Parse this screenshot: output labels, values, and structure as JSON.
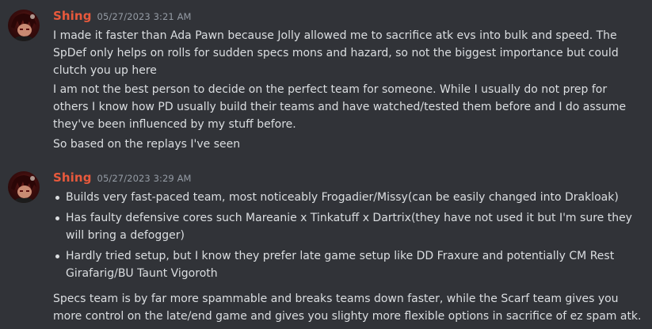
{
  "colors": {
    "background": "#313338",
    "username": "#e8593c",
    "text": "#dbdee1",
    "timestamp": "#949ba4"
  },
  "messages": [
    {
      "author": "Shing",
      "timestamp": "05/27/2023 3:21 AM",
      "avatar_icon": "avatar-image",
      "paragraphs": [
        "I made it faster than Ada Pawn because Jolly allowed me to sacrifice atk evs into bulk and speed. The SpDef only helps on rolls for sudden specs mons and hazard, so not the biggest importance but could clutch you up here",
        "I am not the best person to decide on the perfect team for someone. While I usually do not prep for others I know how PD usually build their teams and have watched/tested them before and I do assume they've been influenced by my stuff before.",
        "So based on the replays I've seen"
      ]
    },
    {
      "author": "Shing",
      "timestamp": "05/27/2023 3:29 AM",
      "avatar_icon": "avatar-image",
      "bullets": [
        "Builds very fast-paced team, most noticeably Frogadier/Missy(can be easily changed into Drakloak)",
        "Has faulty defensive cores such Mareanie x Tinkatuff x Dartrix(they have not used it but I'm sure they will bring a defogger)",
        "Hardly tried setup, but I know they prefer late game setup like DD Fraxure and potentially CM Rest Girafarig/BU Taunt Vigoroth"
      ],
      "closing": "Specs team is by far more spammable and breaks teams down faster, while the Scarf team gives you more control on the late/end game and gives you slighty more flexible options in sacrifice of ez spam atk."
    }
  ]
}
